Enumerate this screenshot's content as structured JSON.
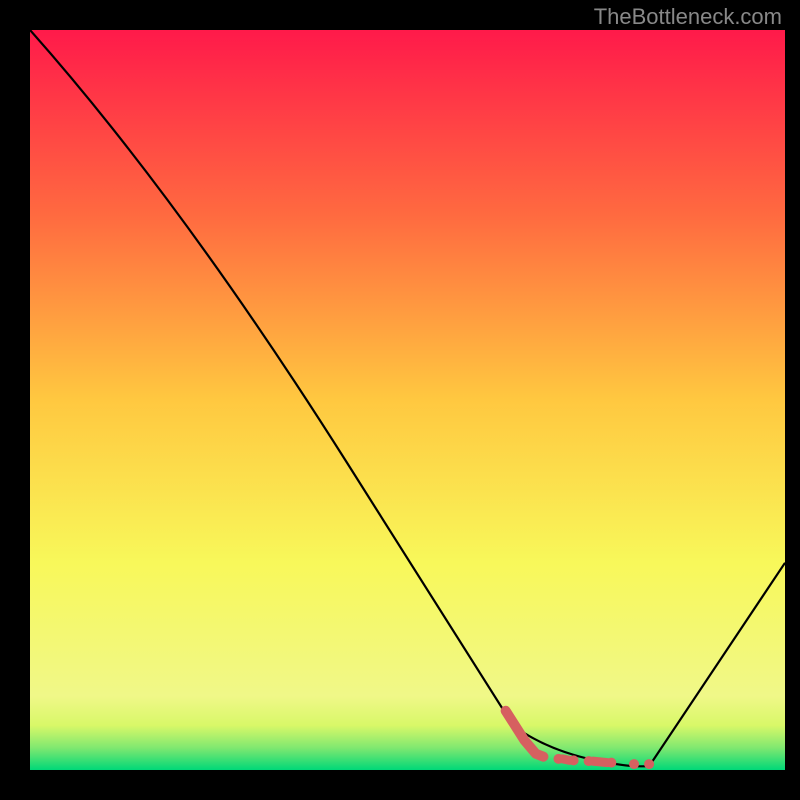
{
  "watermark": "TheBottleneck.com",
  "chart_data": {
    "type": "line",
    "title": "",
    "xlabel": "",
    "ylabel": "",
    "xlim": [
      0,
      100
    ],
    "ylim": [
      0,
      100
    ],
    "gradient_bands": [
      {
        "y_start": 0,
        "y_end": 2,
        "color_from": "#00e676",
        "color_to": "#00e676"
      },
      {
        "y_start": 2,
        "y_end": 6,
        "color_from": "#a8f060",
        "color_to": "#00e676"
      },
      {
        "y_start": 6,
        "y_end": 18,
        "color_from": "#f8f85a",
        "color_to": "#e8f85a"
      },
      {
        "y_start": 18,
        "y_end": 50,
        "color_from": "#ffd040",
        "color_to": "#f8f85a"
      },
      {
        "y_start": 50,
        "y_end": 75,
        "color_from": "#ff7040",
        "color_to": "#ffd040"
      },
      {
        "y_start": 75,
        "y_end": 100,
        "color_from": "#ff1a4a",
        "color_to": "#ff7040"
      }
    ],
    "series": [
      {
        "name": "bottleneck-curve",
        "x": [
          0,
          20,
          64,
          70,
          80,
          82,
          100
        ],
        "y": [
          100,
          77,
          6,
          1.5,
          0.5,
          0.5,
          28
        ],
        "style": "line",
        "color": "#000000",
        "width": 2
      },
      {
        "name": "optimal-marker",
        "x": [
          63,
          65.5,
          67,
          68,
          70,
          72,
          74,
          77,
          80,
          82
        ],
        "y": [
          8,
          4,
          2.2,
          1.8,
          1.5,
          1.3,
          1.2,
          1.0,
          0.8,
          0.8
        ],
        "style": "dotted",
        "color": "#d66060",
        "width": 10
      }
    ]
  }
}
